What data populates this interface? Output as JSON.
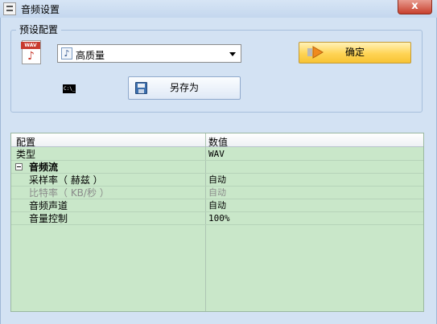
{
  "window": {
    "title": "音频设置",
    "close_label": "x"
  },
  "preset": {
    "group_title": "预设配置",
    "wav_icon_label": "WAV",
    "selected": "高质量",
    "confirm_label": "确定",
    "saveas_label": "另存为",
    "cmd_label": "C:\\_"
  },
  "grid": {
    "header": {
      "key": "配置",
      "value": "数值"
    },
    "rows": [
      {
        "key": "类型",
        "value": "WAV"
      },
      {
        "key": "音频流",
        "value": ""
      },
      {
        "key": "采样率（ 赫兹 ）",
        "value": "自动"
      },
      {
        "key": "比特率（ KB/秒 ）",
        "value": "自动"
      },
      {
        "key": "音频声道",
        "value": "自动"
      },
      {
        "key": "音量控制",
        "value": "100%"
      }
    ]
  }
}
